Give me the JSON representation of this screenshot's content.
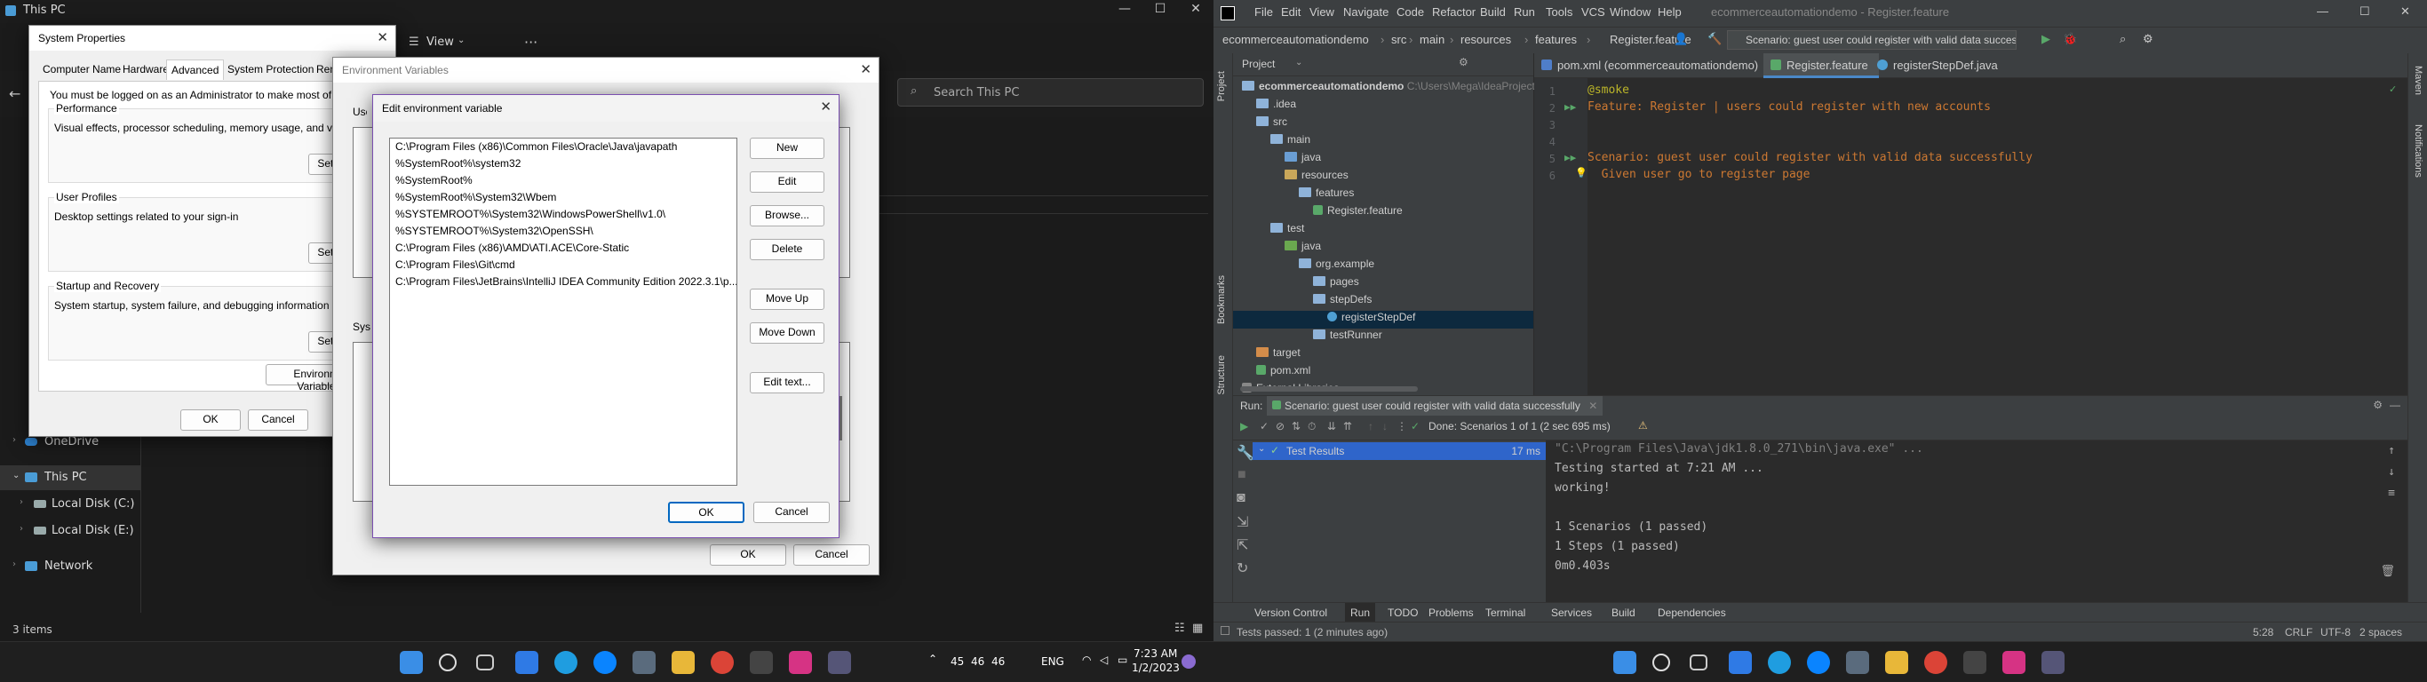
{
  "left": {
    "window_title": "This PC",
    "toolbar_view": "View",
    "search_placeholder": "Search This PC",
    "nav": [
      "OneDrive",
      "This PC",
      "Local Disk (C:)",
      "Local Disk (E:)",
      "Network"
    ],
    "status": "3 items",
    "system_properties": {
      "title": "System Properties",
      "tabs": [
        "Computer Name",
        "Hardware",
        "Advanced",
        "System Protection",
        "Remote"
      ],
      "active_tab": "Advanced",
      "admin_note": "You must be logged on as an Administrator to make most of these changes.",
      "performance_label": "Performance",
      "performance_desc": "Visual effects, processor scheduling, memory usage, and virtual memory",
      "profiles_label": "User Profiles",
      "profiles_desc": "Desktop settings related to your sign-in",
      "startup_label": "Startup and Recovery",
      "startup_desc": "System startup, system failure, and debugging information",
      "settings_btn": "Settings...",
      "env_btn": "Environment Variables...",
      "ok": "OK",
      "cancel": "Cancel"
    },
    "env_vars": {
      "title": "Environment Variables",
      "user_label": "User variables",
      "system_label": "System variables",
      "ok": "OK",
      "cancel": "Cancel"
    },
    "edit_env": {
      "title": "Edit environment variable",
      "paths": [
        "C:\\Program Files (x86)\\Common Files\\Oracle\\Java\\javapath",
        "%SystemRoot%\\system32",
        "%SystemRoot%",
        "%SystemRoot%\\System32\\Wbem",
        "%SYSTEMROOT%\\System32\\WindowsPowerShell\\v1.0\\",
        "%SYSTEMROOT%\\System32\\OpenSSH\\",
        "C:\\Program Files (x86)\\AMD\\ATI.ACE\\Core-Static",
        "C:\\Program Files\\Git\\cmd",
        "C:\\Program Files\\JetBrains\\IntelliJ IDEA Community Edition 2022.3.1\\p..."
      ],
      "buttons": {
        "new": "New",
        "edit": "Edit",
        "browse": "Browse...",
        "delete": "Delete",
        "move_up": "Move Up",
        "move_down": "Move Down",
        "edit_text": "Edit text..."
      },
      "ok": "OK",
      "cancel": "Cancel"
    },
    "taskbar": {
      "tray_nums": [
        "45",
        "46",
        "46"
      ],
      "lang": "ENG",
      "time": "7:23 AM",
      "date": "1/2/2023"
    }
  },
  "right": {
    "menu": [
      "File",
      "Edit",
      "View",
      "Navigate",
      "Code",
      "Refactor",
      "Build",
      "Run",
      "Tools",
      "VCS",
      "Window",
      "Help"
    ],
    "window_title": "ecommerceautomationdemo - Register.feature",
    "breadcrumb": [
      "ecommerceautomationdemo",
      "src",
      "main",
      "resources",
      "features",
      "Register.feature"
    ],
    "run_config": "Scenario: guest user could register with valid data successfully",
    "project_label": "Project",
    "tree": [
      {
        "label": "ecommerceautomationdemo",
        "extra": "C:\\Users\\Mega\\IdeaProjects",
        "depth": 0,
        "kind": "module"
      },
      {
        "label": ".idea",
        "depth": 1,
        "kind": "folder"
      },
      {
        "label": "src",
        "depth": 1,
        "kind": "folder"
      },
      {
        "label": "main",
        "depth": 2,
        "kind": "folder"
      },
      {
        "label": "java",
        "depth": 3,
        "kind": "src"
      },
      {
        "label": "resources",
        "depth": 3,
        "kind": "res"
      },
      {
        "label": "features",
        "depth": 4,
        "kind": "folder"
      },
      {
        "label": "Register.feature",
        "depth": 5,
        "kind": "file"
      },
      {
        "label": "test",
        "depth": 2,
        "kind": "folder"
      },
      {
        "label": "java",
        "depth": 3,
        "kind": "test"
      },
      {
        "label": "org.example",
        "depth": 4,
        "kind": "folder"
      },
      {
        "label": "pages",
        "depth": 5,
        "kind": "folder"
      },
      {
        "label": "stepDefs",
        "depth": 5,
        "kind": "folder"
      },
      {
        "label": "registerStepDef",
        "depth": 6,
        "kind": "class"
      },
      {
        "label": "testRunner",
        "depth": 5,
        "kind": "folder"
      },
      {
        "label": "target",
        "depth": 1,
        "kind": "orange"
      },
      {
        "label": "pom.xml",
        "depth": 1,
        "kind": "file"
      },
      {
        "label": "External Libraries",
        "depth": 0,
        "kind": "lib"
      }
    ],
    "editor_tabs": [
      "pom.xml (ecommerceautomationdemo)",
      "Register.feature",
      "registerStepDef.java"
    ],
    "active_editor_tab": "Register.feature",
    "code_lines": [
      {
        "n": "1",
        "text": "@smoke"
      },
      {
        "n": "2",
        "text": "Feature: Register | users could register with new accounts"
      },
      {
        "n": "3",
        "text": ""
      },
      {
        "n": "4",
        "text": ""
      },
      {
        "n": "5",
        "text": "Scenario: guest user could register with valid data successfully"
      },
      {
        "n": "6",
        "text": "  Given user go to register page"
      }
    ],
    "run_label": "Run:",
    "run_tab": "Scenario: guest user could register with valid data successfully",
    "run_status": "Done: Scenarios 1 of 1  (2 sec 695 ms)",
    "test_results_label": "Test Results",
    "test_results_time": "17 ms",
    "console": [
      "\"C:\\Program Files\\Java\\jdk1.8.0_271\\bin\\java.exe\" ...",
      "Testing started at 7:21 AM ...",
      "working!",
      "",
      "1 Scenarios (1 passed)",
      "1 Steps (1 passed)",
      "0m0.403s"
    ],
    "bottom_tools": [
      "Version Control",
      "Run",
      "TODO",
      "Problems",
      "Terminal",
      "Services",
      "Build",
      "Dependencies"
    ],
    "status_left": "Tests passed: 1 (2 minutes ago)",
    "status_right": [
      "5:28",
      "CRLF",
      "UTF-8",
      "2 spaces"
    ],
    "side_left": [
      "Project",
      "Bookmarks",
      "Structure"
    ],
    "side_right": [
      "Maven",
      "Notifications"
    ]
  }
}
